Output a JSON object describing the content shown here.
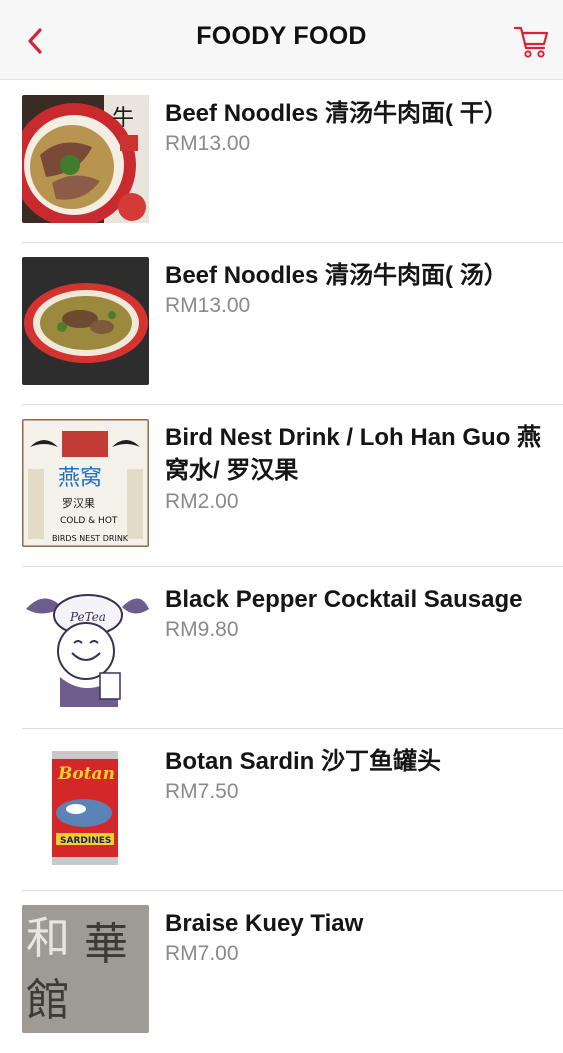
{
  "header": {
    "title": "FOODY FOOD",
    "back_icon": "chevron-left-icon",
    "cart_icon": "shopping-cart-icon",
    "accent_color": "#d6223a"
  },
  "items": [
    {
      "name": "Beef Noodles 清汤牛肉面( 干）",
      "price": "RM13.00"
    },
    {
      "name": "Beef Noodles 清汤牛肉面( 汤）",
      "price": "RM13.00"
    },
    {
      "name": "Bird Nest Drink / Loh Han Guo 燕窝水/ 罗汉果",
      "price": "RM2.00"
    },
    {
      "name": "Black Pepper Cocktail Sausage",
      "price": "RM9.80"
    },
    {
      "name": "Botan Sardin 沙丁鱼罐头",
      "price": "RM7.50"
    },
    {
      "name": "Braise Kuey Tiaw",
      "price": "RM7.00"
    }
  ]
}
